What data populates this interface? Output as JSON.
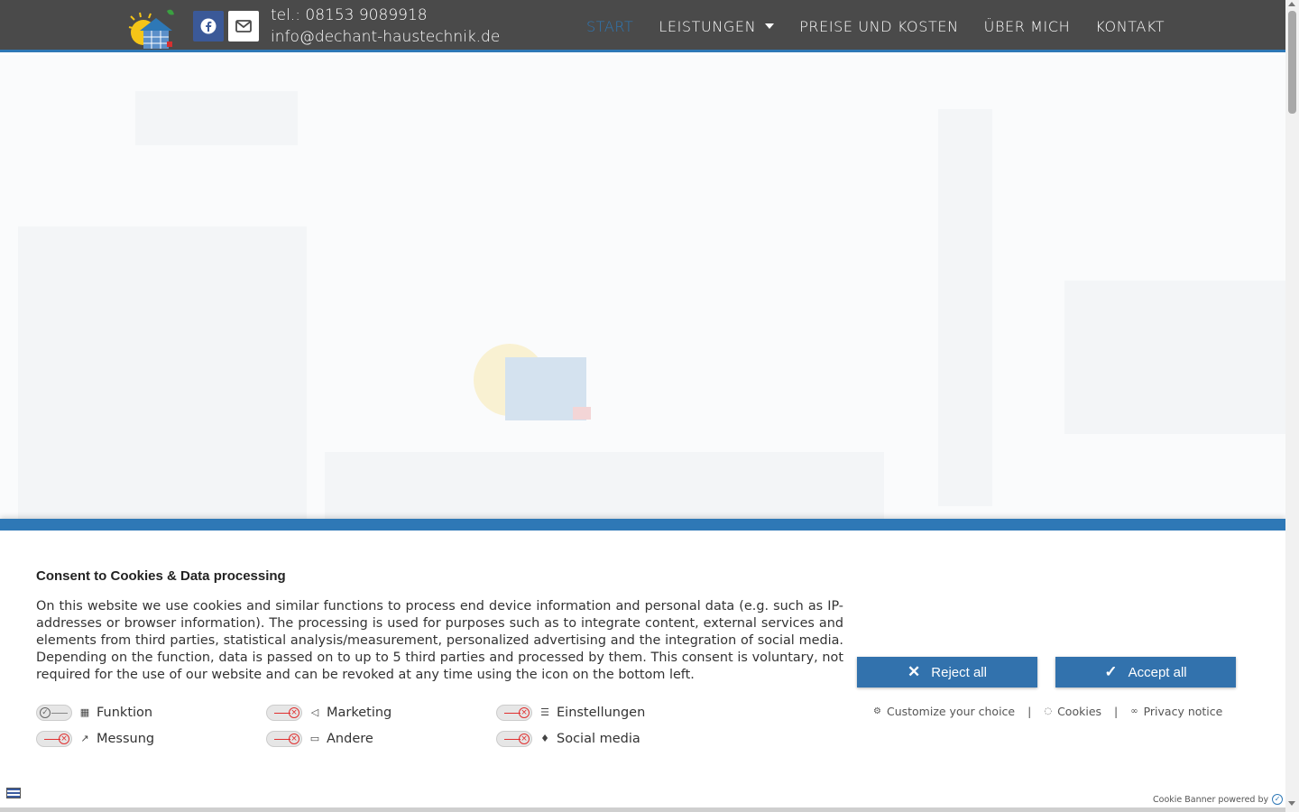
{
  "header": {
    "phone": "tel.: 08153 9089918",
    "email": "info@dechant-haustechnik.de",
    "accent_color": "#2e78b6",
    "nav": [
      {
        "label": "START",
        "active": true
      },
      {
        "label": "LEISTUNGEN",
        "dropdown": true
      },
      {
        "label": "PREISE UND KOSTEN"
      },
      {
        "label": "ÜBER MICH"
      },
      {
        "label": "KONTAKT"
      }
    ]
  },
  "icons": {
    "facebook": "facebook-icon",
    "mail": "envelope-icon"
  },
  "consent": {
    "title": "Consent to Cookies & Data processing",
    "text": "On this website we use cookies and similar functions to process end device information and personal data (e.g. such as IP-addresses or browser information). The processing is used for purposes such as to integrate content, external services and elements from third parties, statistical analysis/measurement, personalized advertising and the integration of social media. Depending on the function, data is passed on to up to 5 third parties and processed by them. This consent is voluntary, not required for the use of our website and can be revoked at any time using the icon on the bottom left.",
    "toggles": [
      {
        "label": "Funktion",
        "on": true,
        "icon": "grid-icon"
      },
      {
        "label": "Marketing",
        "on": false,
        "icon": "megaphone-icon"
      },
      {
        "label": "Einstellungen",
        "on": false,
        "icon": "sliders-icon"
      },
      {
        "label": "Messung",
        "on": false,
        "icon": "chart-icon"
      },
      {
        "label": "Andere",
        "on": false,
        "icon": "chat-icon"
      },
      {
        "label": "Social media",
        "on": false,
        "icon": "thumbs-up-icon"
      }
    ],
    "reject_label": "Reject all",
    "accept_label": "Accept all",
    "customize_label": "Customize your choice",
    "cookies_label": "Cookies",
    "privacy_label": "Privacy notice",
    "powered_by": "Cookie Banner powered by",
    "separator": "|"
  }
}
